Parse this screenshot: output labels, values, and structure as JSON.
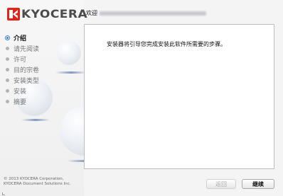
{
  "header": {
    "title": "欢迎"
  },
  "logo": {
    "text": "KYOCERA",
    "color": "#e2231a"
  },
  "sidebar": {
    "items": [
      {
        "label": "介绍",
        "active": true
      },
      {
        "label": "请先阅读",
        "active": false
      },
      {
        "label": "许可",
        "active": false
      },
      {
        "label": "目的宗卷",
        "active": false
      },
      {
        "label": "安装类型",
        "active": false
      },
      {
        "label": "安装",
        "active": false
      },
      {
        "label": "摘要",
        "active": false
      }
    ],
    "copyright_line1": "© 2013 KYOCERA Corporation,",
    "copyright_line2": "KYOCERA Document Solutions Inc."
  },
  "main": {
    "body_text": "安装器将引导您完成安装此软件所需要的步骤。"
  },
  "footer": {
    "back_label": "返回",
    "continue_label": "继续"
  },
  "colors": {
    "active_indicator": "#3c7cd6",
    "brand": "#e2231a"
  }
}
